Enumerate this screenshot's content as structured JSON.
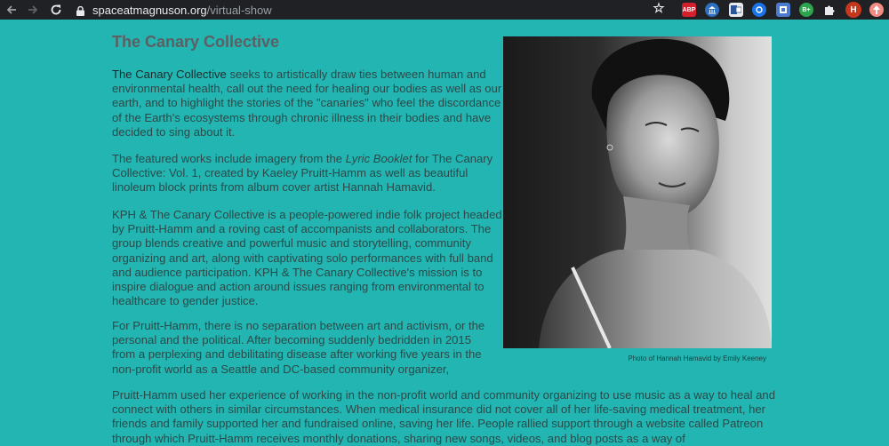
{
  "browser": {
    "url_host": "spaceatmagnuson.org",
    "url_path": "/virtual-show",
    "extensions": [
      "ABP",
      "B+"
    ],
    "avatar_letter": "H",
    "icons": [
      "back-arrow-icon",
      "forward-arrow-icon",
      "reload-icon",
      "lock-icon",
      "star-icon",
      "puzzle-icon"
    ]
  },
  "page": {
    "title": "The Canary Collective",
    "p1_lead": "The Canary Collective",
    "p1_rest": " seeks to artistically draw ties between human and environmental health, call out the need for healing our bodies as well as our earth, and to highlight the stories of the \"canaries\" who feel the discordance of the Earth's ecosystems through chronic illness in their bodies and have decided to sing about it.",
    "p2_before": "The featured works include imagery from the ",
    "p2_em": "Lyric Booklet",
    "p2_after": " for The Canary Collective: Vol. 1, created by Kaeley Pruitt-Hamm as well as beautiful linoleum block prints from album cover artist Hannah Hamavid.",
    "p3": "KPH & The Canary Collective is a people-powered indie folk project headed by Pruitt-Hamm and a roving cast of accompanists and collaborators. The group blends creative and powerful music and storytelling, community organizing and art, along with captivating solo performances with full band and audience participation. KPH & The Canary Collective's mission is to inspire dialogue and action around issues ranging from environmental to healthcare to gender justice.",
    "p4": "For Pruitt-Hamm, there is no separation between art and activism, or the personal and the political. After becoming suddenly bedridden  in 2015 from a perplexing and debilitating disease after working five years in the non-profit world as a Seattle and DC-based community organizer,",
    "p5": "Pruitt-Hamm used her experience of working in the non-profit world and community organizing to use music as a way to heal and connect with others in similar circumstances. When medical insurance did not cover all of her life-saving medical treatment, her friends and family supported her and fundraised online, saving her life. People rallied support through a website called Patreon through which Pruitt-Hamm receives monthly donations, sharing new songs, videos, and blog posts as a way of",
    "photo_caption": "Photo of Hannah Hamavid by Emily Keeney"
  },
  "colors": {
    "background": "#23b5b1",
    "title": "#5c5f63",
    "text": "#2b4a4a"
  }
}
